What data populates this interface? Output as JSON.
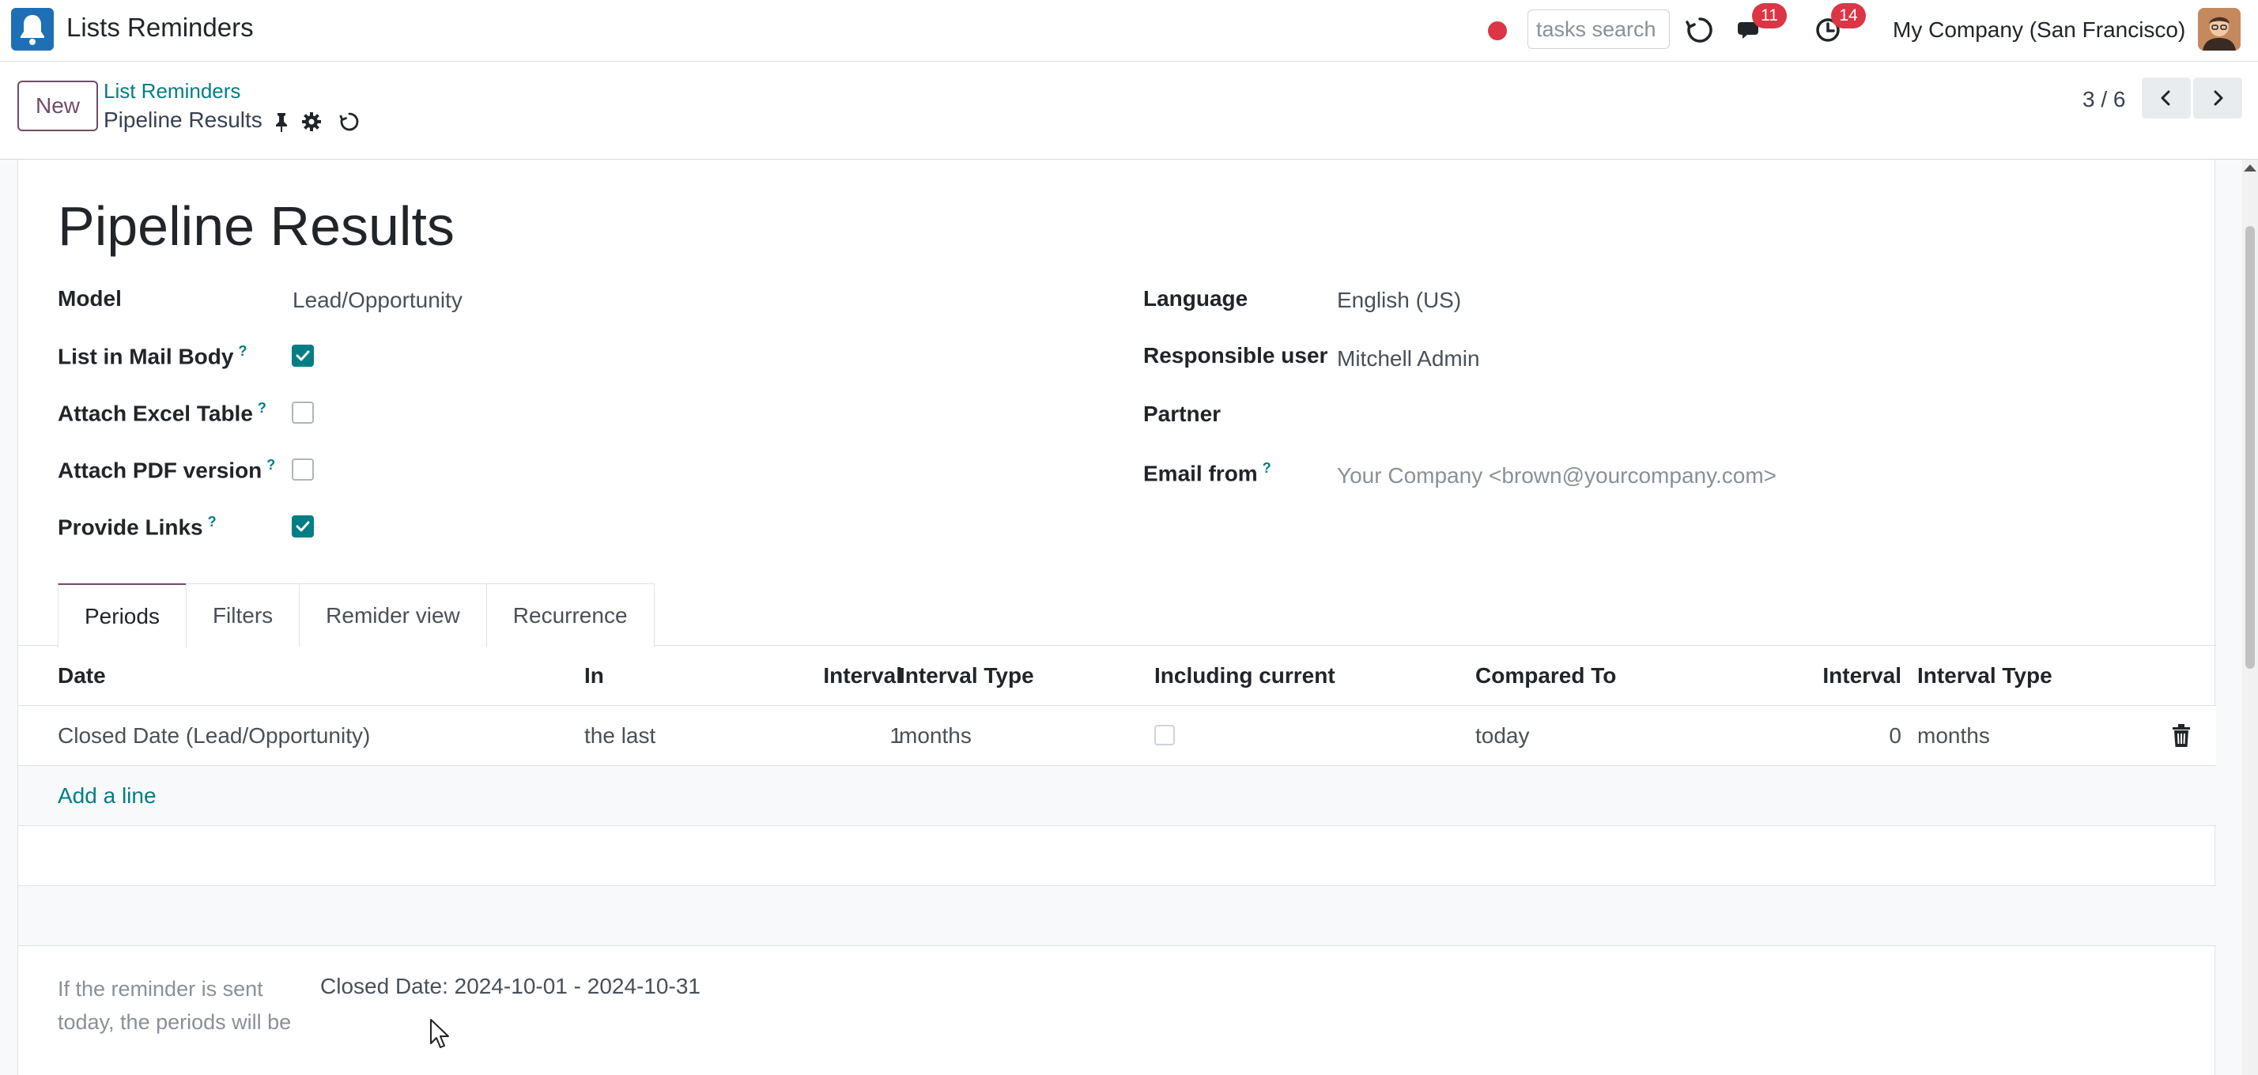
{
  "navbar": {
    "app_title": "Lists Reminders",
    "search_placeholder": "tasks search",
    "messages_count": "11",
    "activities_count": "14",
    "company": "My Company (San Francisco)"
  },
  "control_panel": {
    "new_label": "New",
    "breadcrumb_parent": "List Reminders",
    "record_title": "Pipeline Results",
    "pager_value": "3 / 6"
  },
  "form": {
    "title": "Pipeline Results",
    "left_fields": {
      "model_label": "Model",
      "model_value": "Lead/Opportunity",
      "list_in_mail_body_label": "List in Mail Body",
      "list_in_mail_body_checked": true,
      "attach_excel_label": "Attach Excel Table",
      "attach_excel_checked": false,
      "attach_pdf_label": "Attach PDF version",
      "attach_pdf_checked": false,
      "provide_links_label": "Provide Links",
      "provide_links_checked": true
    },
    "right_fields": {
      "language_label": "Language",
      "language_value": "English (US)",
      "responsible_label": "Responsible user",
      "responsible_value": "Mitchell Admin",
      "partner_label": "Partner",
      "partner_value": "",
      "email_from_label": "Email from",
      "email_from_value": "Your Company <brown@yourcompany.com>"
    },
    "help_mark": "?"
  },
  "tabs": [
    {
      "label": "Periods",
      "active": true
    },
    {
      "label": "Filters",
      "active": false
    },
    {
      "label": "Remider view",
      "active": false
    },
    {
      "label": "Recurrence",
      "active": false
    }
  ],
  "periods_table": {
    "headers": {
      "date": "Date",
      "in": "In",
      "interval": "Interval",
      "interval_type": "Interval Type",
      "including_current": "Including current",
      "compared_to": "Compared To",
      "interval2": "Interval",
      "interval_type2": "Interval Type"
    },
    "rows": [
      {
        "date": "Closed Date (Lead/Opportunity)",
        "in": "the last",
        "interval": "1",
        "interval_type": "months",
        "including_current": false,
        "compared_to": "today",
        "interval2": "0",
        "interval_type2": "months"
      }
    ],
    "add_line_label": "Add a line"
  },
  "periods_preview": {
    "label": "If the reminder is sent today, the periods will be",
    "value": "Closed Date: 2024-10-01 - 2024-10-31"
  },
  "colors": {
    "primary": "#714b67",
    "link": "#017e84",
    "badge": "#dc3545"
  }
}
